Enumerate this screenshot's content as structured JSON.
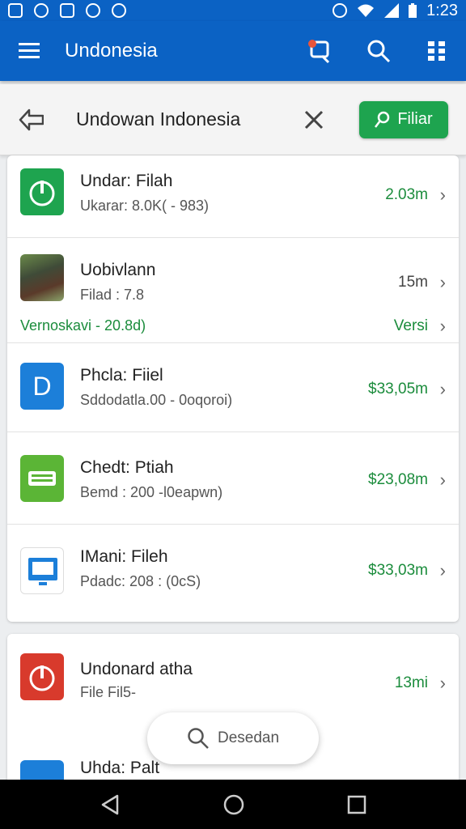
{
  "status_bar": {
    "time": "1:23"
  },
  "app_bar": {
    "title": "Undonesia"
  },
  "search": {
    "query": "Undowan Indonesia",
    "filter_label": "Filiar"
  },
  "list": [
    {
      "name": "Undar: Filah",
      "sub": "Ukarar: 8.0K( - 983)",
      "value": "2.03m",
      "thumb_color": "#1ea44f",
      "icon": "power-icon"
    },
    {
      "name": "Uobivlann",
      "sub": "Filad : 7.8",
      "value": "15m",
      "note": "Vernoskavi - 20.8d)",
      "note_right": "Versi",
      "icon": "photo-thumbnail"
    },
    {
      "name": "Phcla: Fiiel",
      "sub": "Sddodatla.00 - 0oqoroi)",
      "value": "$33,05m",
      "thumb_color": "#1c7fd9",
      "icon": "d-letter-icon"
    },
    {
      "name": "Chedt: Ptiah",
      "sub": "Bemd : 200 -l0eapwn)",
      "value": "$23,08m",
      "thumb_color": "#5bb536",
      "icon": "keyboard-icon"
    },
    {
      "name": "IMani: Fileh",
      "sub": "Pdadc: 208 : (0cS)",
      "value": "$33,03m",
      "thumb_color": "#1c7fd9",
      "icon": "monitor-icon"
    }
  ],
  "list2": [
    {
      "name": "Undonard atha",
      "sub": "File Fil5-",
      "value": "13mi",
      "thumb_color": "#d83a2c",
      "icon": "power-icon"
    },
    {
      "name": "Uhda: Palt",
      "value": ""
    }
  ],
  "floating": {
    "label": "Desedan"
  }
}
